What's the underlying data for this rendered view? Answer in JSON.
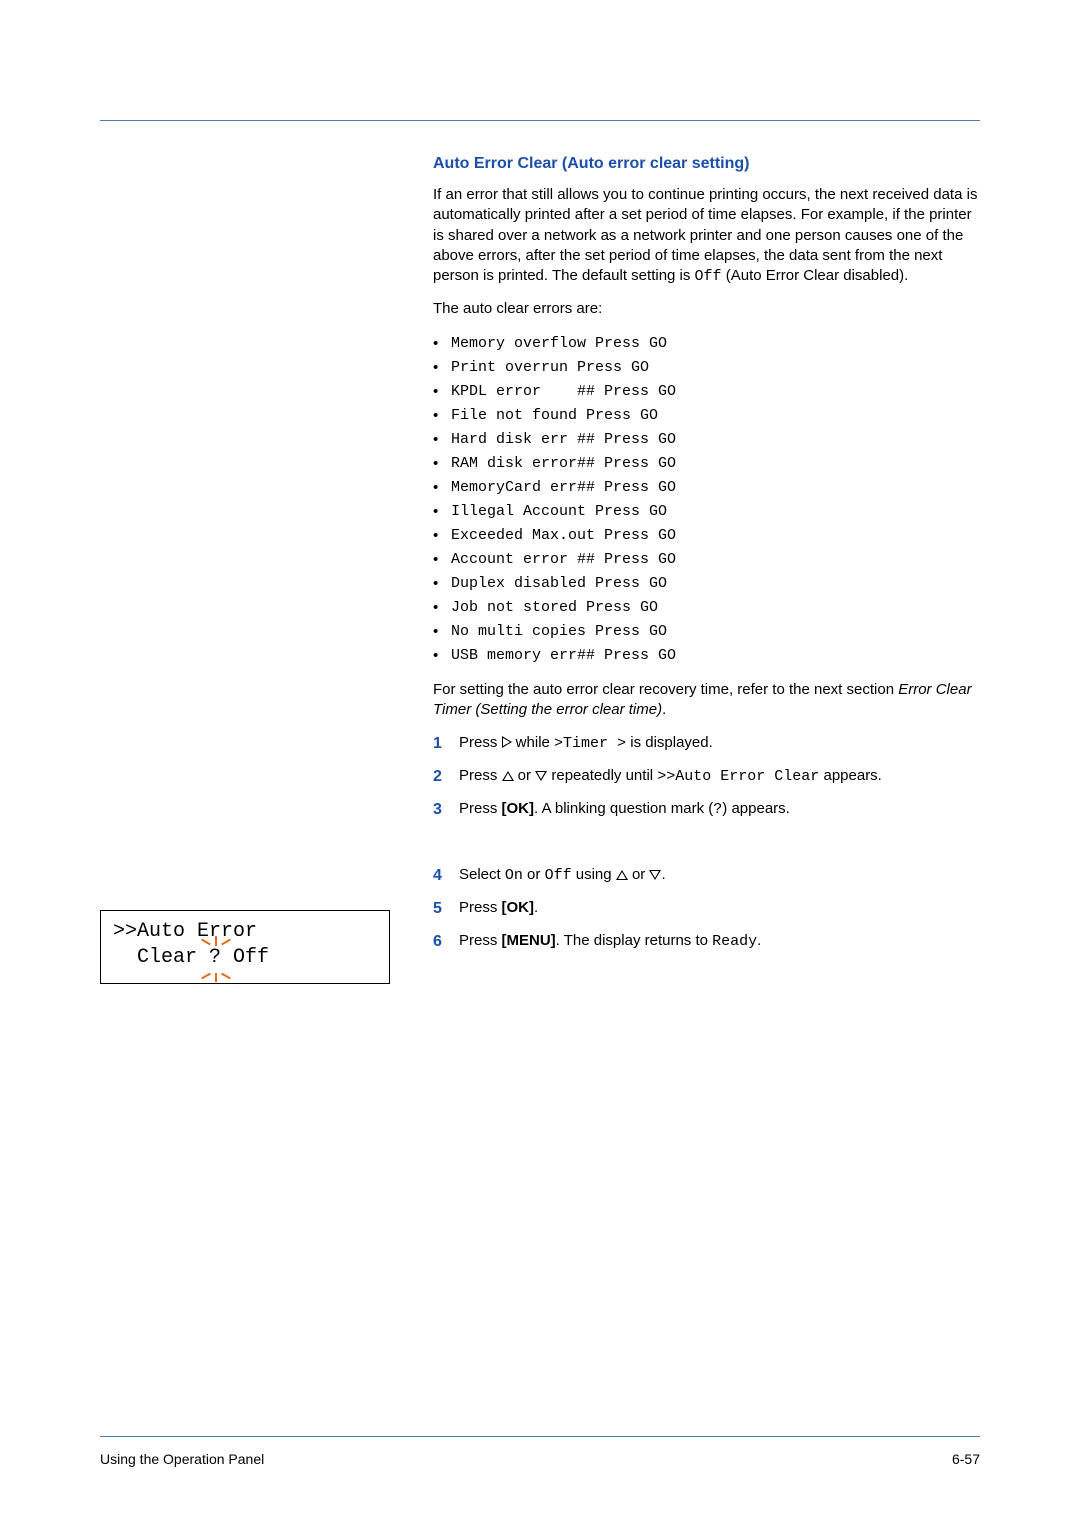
{
  "footer": {
    "left": "Using the Operation Panel",
    "right": "6-57"
  },
  "section": {
    "title": "Auto Error Clear (Auto error clear setting)",
    "intro_pre": "If an error that still allows you to continue printing occurs, the next received data is automatically printed after a set period of time elapses. For example, if the printer is shared over a network as a network printer and one person causes one of the above errors, after the set period of time elapses, the data sent from the next person is printed. The default setting is ",
    "intro_code": "Off",
    "intro_post": " (Auto Error Clear disabled).",
    "errors_intro": "The auto clear errors are:",
    "errors": [
      "Memory overflow Press GO",
      "Print overrun Press GO",
      "KPDL error    ## Press GO",
      "File not found Press GO",
      "Hard disk err ## Press GO",
      "RAM disk error## Press GO",
      "MemoryCard err## Press GO",
      "Illegal Account Press GO",
      "Exceeded Max.out Press GO",
      "Account error ## Press GO",
      "Duplex disabled Press GO",
      "Job not stored Press GO",
      "No multi copies Press GO",
      "USB memory err## Press GO"
    ],
    "recovery_pre": "For setting the auto error clear recovery time, refer to the next section ",
    "recovery_italic": "Error Clear Timer (Setting the error clear time)",
    "recovery_post": "."
  },
  "steps": {
    "s1_pre": "Press ",
    "s1_mid": " while ",
    "s1_code": ">Timer  >",
    "s1_post": " is displayed.",
    "s2_pre": "Press ",
    "s2_or": " or ",
    "s2_mid": " repeatedly until ",
    "s2_code": ">>Auto Error Clear",
    "s2_post": " appears.",
    "s3_pre": "Press ",
    "s3_bold": "[OK]",
    "s3_mid": ". A blinking question mark (",
    "s3_code": "?",
    "s3_post": ") appears.",
    "s4_pre": "Select ",
    "s4_on": "On",
    "s4_or1": " or ",
    "s4_off": "Off",
    "s4_using": " using ",
    "s4_or2": " or ",
    "s4_post": ".",
    "s5_pre": "Press ",
    "s5_bold": "[OK]",
    "s5_post": ".",
    "s6_pre": "Press ",
    "s6_bold": "[MENU]",
    "s6_mid": ". The display returns to ",
    "s6_code": "Ready",
    "s6_post": "."
  },
  "lcd": {
    "line1": ">>Auto Error",
    "line2a": "  Clear ",
    "line2q": "?",
    "line2b": " Off"
  }
}
